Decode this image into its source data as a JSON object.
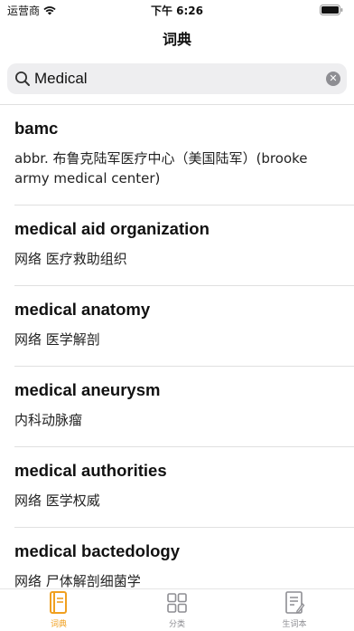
{
  "status_bar": {
    "carrier": "运营商",
    "time": "下午 6:26"
  },
  "nav": {
    "title": "词典"
  },
  "search": {
    "value": "Medical",
    "placeholder": ""
  },
  "entries": [
    {
      "word": "bamc",
      "definition": "abbr.  布鲁克陆军医疗中心（美国陆军）(brooke army medical center)"
    },
    {
      "word": "medical aid organization",
      "definition": "网络  医疗救助组织"
    },
    {
      "word": "medical anatomy",
      "definition": "网络  医学解剖"
    },
    {
      "word": "medical aneurysm",
      "definition": "内科动脉瘤"
    },
    {
      "word": "medical authorities",
      "definition": "网络  医学权威"
    },
    {
      "word": "medical bactedology",
      "definition": "网络  尸体解剖细菌学"
    }
  ],
  "tab_bar": {
    "tabs": [
      {
        "label": "词典",
        "icon": "book-icon",
        "active": true
      },
      {
        "label": "分类",
        "icon": "grid-icon",
        "active": false
      },
      {
        "label": "生词本",
        "icon": "notebook-icon",
        "active": false
      }
    ]
  },
  "colors": {
    "accent": "#f0a020",
    "inactive": "#8e8e93",
    "search_bg": "#eeeef0",
    "divider": "#e0e0e0"
  }
}
